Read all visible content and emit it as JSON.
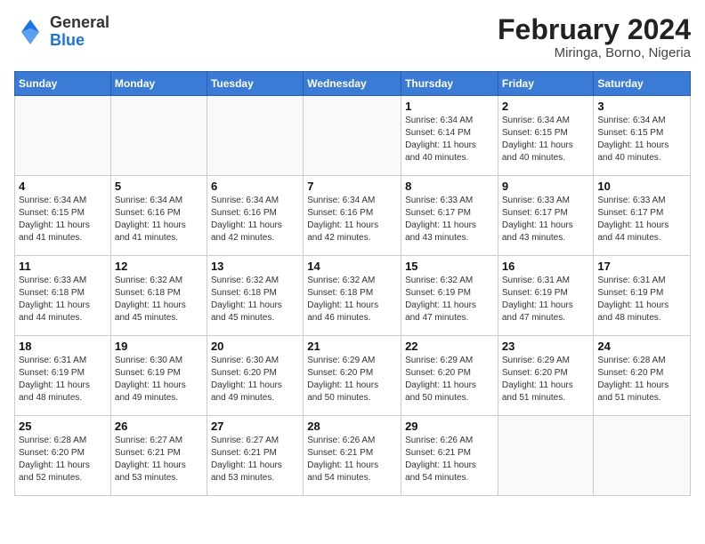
{
  "header": {
    "logo_general": "General",
    "logo_blue": "Blue",
    "main_title": "February 2024",
    "subtitle": "Miringa, Borno, Nigeria"
  },
  "calendar": {
    "days_of_week": [
      "Sunday",
      "Monday",
      "Tuesday",
      "Wednesday",
      "Thursday",
      "Friday",
      "Saturday"
    ],
    "weeks": [
      [
        {
          "day": "",
          "info": ""
        },
        {
          "day": "",
          "info": ""
        },
        {
          "day": "",
          "info": ""
        },
        {
          "day": "",
          "info": ""
        },
        {
          "day": "1",
          "info": "Sunrise: 6:34 AM\nSunset: 6:14 PM\nDaylight: 11 hours\nand 40 minutes."
        },
        {
          "day": "2",
          "info": "Sunrise: 6:34 AM\nSunset: 6:15 PM\nDaylight: 11 hours\nand 40 minutes."
        },
        {
          "day": "3",
          "info": "Sunrise: 6:34 AM\nSunset: 6:15 PM\nDaylight: 11 hours\nand 40 minutes."
        }
      ],
      [
        {
          "day": "4",
          "info": "Sunrise: 6:34 AM\nSunset: 6:15 PM\nDaylight: 11 hours\nand 41 minutes."
        },
        {
          "day": "5",
          "info": "Sunrise: 6:34 AM\nSunset: 6:16 PM\nDaylight: 11 hours\nand 41 minutes."
        },
        {
          "day": "6",
          "info": "Sunrise: 6:34 AM\nSunset: 6:16 PM\nDaylight: 11 hours\nand 42 minutes."
        },
        {
          "day": "7",
          "info": "Sunrise: 6:34 AM\nSunset: 6:16 PM\nDaylight: 11 hours\nand 42 minutes."
        },
        {
          "day": "8",
          "info": "Sunrise: 6:33 AM\nSunset: 6:17 PM\nDaylight: 11 hours\nand 43 minutes."
        },
        {
          "day": "9",
          "info": "Sunrise: 6:33 AM\nSunset: 6:17 PM\nDaylight: 11 hours\nand 43 minutes."
        },
        {
          "day": "10",
          "info": "Sunrise: 6:33 AM\nSunset: 6:17 PM\nDaylight: 11 hours\nand 44 minutes."
        }
      ],
      [
        {
          "day": "11",
          "info": "Sunrise: 6:33 AM\nSunset: 6:18 PM\nDaylight: 11 hours\nand 44 minutes."
        },
        {
          "day": "12",
          "info": "Sunrise: 6:32 AM\nSunset: 6:18 PM\nDaylight: 11 hours\nand 45 minutes."
        },
        {
          "day": "13",
          "info": "Sunrise: 6:32 AM\nSunset: 6:18 PM\nDaylight: 11 hours\nand 45 minutes."
        },
        {
          "day": "14",
          "info": "Sunrise: 6:32 AM\nSunset: 6:18 PM\nDaylight: 11 hours\nand 46 minutes."
        },
        {
          "day": "15",
          "info": "Sunrise: 6:32 AM\nSunset: 6:19 PM\nDaylight: 11 hours\nand 47 minutes."
        },
        {
          "day": "16",
          "info": "Sunrise: 6:31 AM\nSunset: 6:19 PM\nDaylight: 11 hours\nand 47 minutes."
        },
        {
          "day": "17",
          "info": "Sunrise: 6:31 AM\nSunset: 6:19 PM\nDaylight: 11 hours\nand 48 minutes."
        }
      ],
      [
        {
          "day": "18",
          "info": "Sunrise: 6:31 AM\nSunset: 6:19 PM\nDaylight: 11 hours\nand 48 minutes."
        },
        {
          "day": "19",
          "info": "Sunrise: 6:30 AM\nSunset: 6:19 PM\nDaylight: 11 hours\nand 49 minutes."
        },
        {
          "day": "20",
          "info": "Sunrise: 6:30 AM\nSunset: 6:20 PM\nDaylight: 11 hours\nand 49 minutes."
        },
        {
          "day": "21",
          "info": "Sunrise: 6:29 AM\nSunset: 6:20 PM\nDaylight: 11 hours\nand 50 minutes."
        },
        {
          "day": "22",
          "info": "Sunrise: 6:29 AM\nSunset: 6:20 PM\nDaylight: 11 hours\nand 50 minutes."
        },
        {
          "day": "23",
          "info": "Sunrise: 6:29 AM\nSunset: 6:20 PM\nDaylight: 11 hours\nand 51 minutes."
        },
        {
          "day": "24",
          "info": "Sunrise: 6:28 AM\nSunset: 6:20 PM\nDaylight: 11 hours\nand 51 minutes."
        }
      ],
      [
        {
          "day": "25",
          "info": "Sunrise: 6:28 AM\nSunset: 6:20 PM\nDaylight: 11 hours\nand 52 minutes."
        },
        {
          "day": "26",
          "info": "Sunrise: 6:27 AM\nSunset: 6:21 PM\nDaylight: 11 hours\nand 53 minutes."
        },
        {
          "day": "27",
          "info": "Sunrise: 6:27 AM\nSunset: 6:21 PM\nDaylight: 11 hours\nand 53 minutes."
        },
        {
          "day": "28",
          "info": "Sunrise: 6:26 AM\nSunset: 6:21 PM\nDaylight: 11 hours\nand 54 minutes."
        },
        {
          "day": "29",
          "info": "Sunrise: 6:26 AM\nSunset: 6:21 PM\nDaylight: 11 hours\nand 54 minutes."
        },
        {
          "day": "",
          "info": ""
        },
        {
          "day": "",
          "info": ""
        }
      ]
    ]
  }
}
